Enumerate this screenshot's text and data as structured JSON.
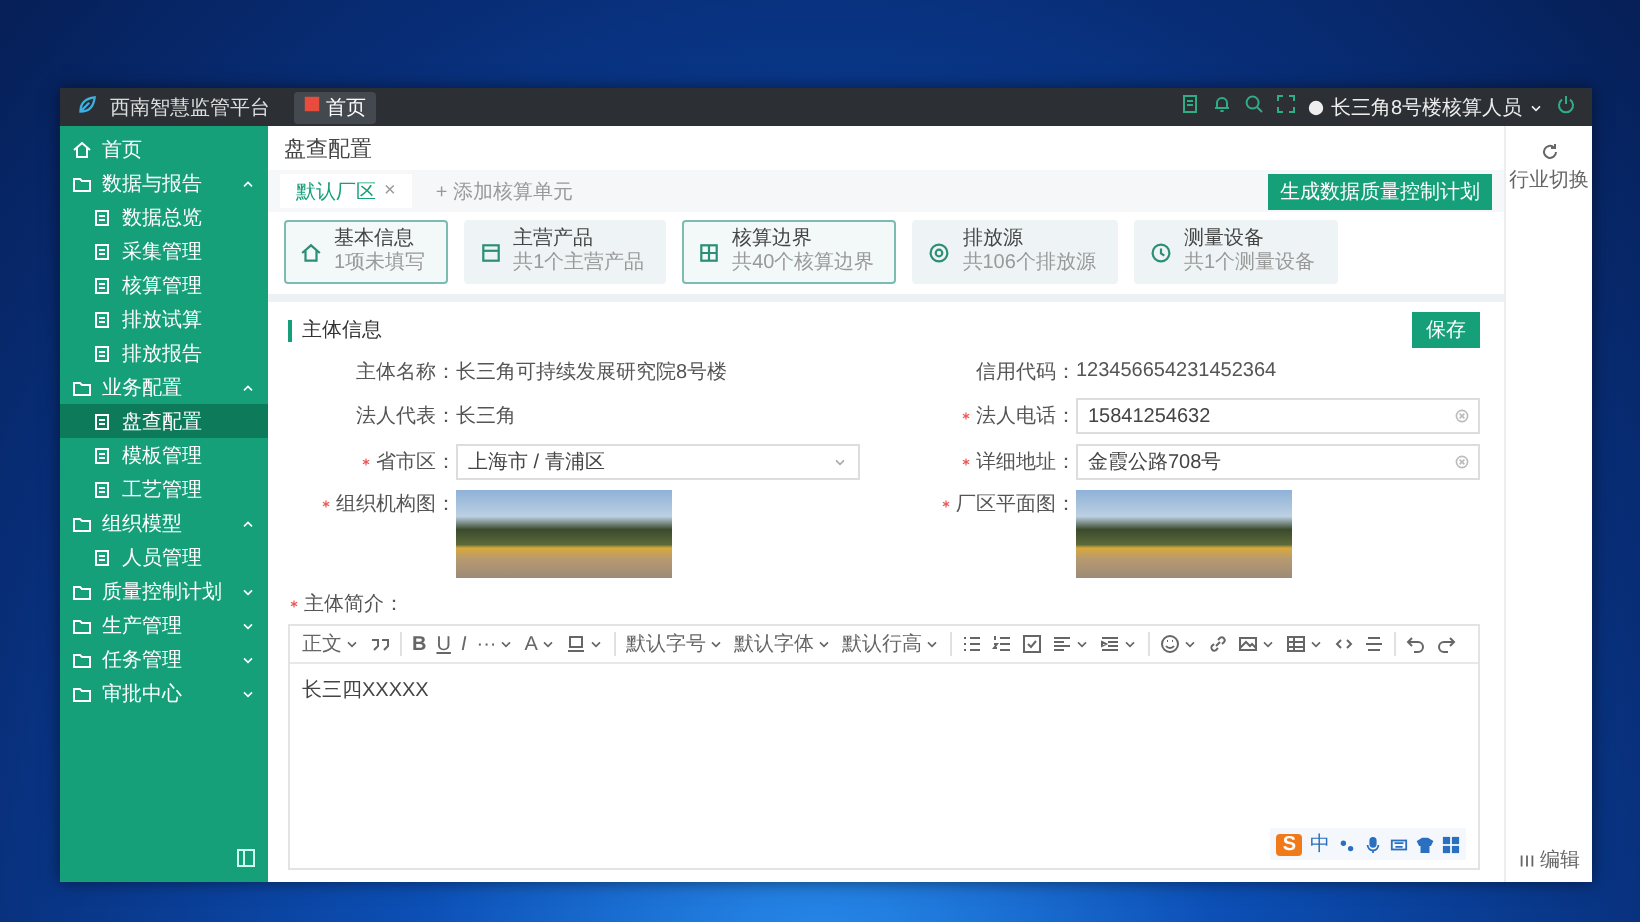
{
  "header": {
    "title": "西南智慧监管平台",
    "tabs": [
      {
        "label": "首页",
        "selected": true
      }
    ],
    "user": "长三角8号楼核算人员"
  },
  "sidebar": {
    "items": [
      {
        "label": "首页",
        "selected": false
      },
      {
        "label": "数据与报告",
        "selected": false,
        "expanded": true,
        "children": [
          {
            "label": "数据总览",
            "selected": false
          },
          {
            "label": "采集管理",
            "selected": false
          },
          {
            "label": "核算管理",
            "selected": false
          },
          {
            "label": "排放试算",
            "selected": false
          },
          {
            "label": "排放报告",
            "selected": false
          }
        ]
      },
      {
        "label": "业务配置",
        "selected": false,
        "expanded": true,
        "children": [
          {
            "label": "盘查配置",
            "selected": true
          },
          {
            "label": "模板管理",
            "selected": false
          },
          {
            "label": "工艺管理",
            "selected": false
          }
        ]
      },
      {
        "label": "组织模型",
        "selected": false,
        "expanded": true,
        "children": [
          {
            "label": "人员管理",
            "selected": false
          }
        ]
      },
      {
        "label": "质量控制计划",
        "selected": false,
        "expanded": false
      },
      {
        "label": "生产管理",
        "selected": false,
        "expanded": false
      },
      {
        "label": "任务管理",
        "selected": false,
        "expanded": false
      },
      {
        "label": "审批中心",
        "selected": false,
        "expanded": false
      }
    ]
  },
  "page_title": "盘查配置",
  "unit_tabs": [
    {
      "label": "默认厂区",
      "close": "×",
      "selected": true
    },
    {
      "label": "+ 添加核算单元",
      "selected": false
    }
  ],
  "generate_button": "生成数据质量控制计划",
  "steps": [
    {
      "title": "基本信息",
      "subtitle": "1项未填写",
      "selected": true
    },
    {
      "title": "主营产品",
      "subtitle": "共1个主营产品",
      "selected": false
    },
    {
      "title": "核算边界",
      "subtitle": "共40个核算边界",
      "selected": true
    },
    {
      "title": "排放源",
      "subtitle": "共106个排放源",
      "selected": false
    },
    {
      "title": "测量设备",
      "subtitle": "共1个测量设备",
      "selected": false
    }
  ],
  "form": {
    "section": "主体信息",
    "save": "保存",
    "fields": [
      {
        "kind": "text",
        "label": "主体名称：",
        "required": false,
        "value": "长三角可持续发展研究院8号楼"
      },
      {
        "kind": "text",
        "label": "信用代码：",
        "required": false,
        "value": "123456654231452364"
      },
      {
        "kind": "text",
        "label": "法人代表：",
        "required": false,
        "value": "长三角"
      },
      {
        "kind": "input",
        "label": "法人电话：",
        "required": true,
        "value": "15841254632"
      },
      {
        "kind": "select",
        "label": "省市区：",
        "required": true,
        "value": "上海市 / 青浦区"
      },
      {
        "kind": "input",
        "label": "详细地址：",
        "required": true,
        "value": "金霞公路708号"
      },
      {
        "kind": "image",
        "label": "组织机构图：",
        "required": true
      },
      {
        "kind": "image",
        "label": "厂区平面图：",
        "required": true
      }
    ],
    "intro": {
      "label": "主体简介：",
      "required": true,
      "content": "长三四XXXXX",
      "toolbar": [
        {
          "kind": "text",
          "label": "正文",
          "dropdown": true
        },
        {
          "kind": "quote"
        },
        {
          "kind": "divider"
        },
        {
          "kind": "bold",
          "label": "B"
        },
        {
          "kind": "underline",
          "label": "U"
        },
        {
          "kind": "italic",
          "label": "I"
        },
        {
          "kind": "text",
          "label": "···",
          "dropdown": true
        },
        {
          "kind": "text",
          "label": "A",
          "dropdown": true
        },
        {
          "kind": "fill",
          "dropdown": true
        },
        {
          "kind": "divider"
        },
        {
          "kind": "text",
          "label": "默认字号",
          "dropdown": true
        },
        {
          "kind": "text",
          "label": "默认字体",
          "dropdown": true
        },
        {
          "kind": "text",
          "label": "默认行高",
          "dropdown": true
        },
        {
          "kind": "divider"
        },
        {
          "kind": "bullets"
        },
        {
          "kind": "numbers"
        },
        {
          "kind": "todo"
        },
        {
          "kind": "align",
          "dropdown": true
        },
        {
          "kind": "indent",
          "dropdown": true
        },
        {
          "kind": "divider"
        },
        {
          "kind": "emoji",
          "dropdown": true
        },
        {
          "kind": "link"
        },
        {
          "kind": "image",
          "dropdown": true
        },
        {
          "kind": "table",
          "dropdown": true
        },
        {
          "kind": "code"
        },
        {
          "kind": "rule"
        },
        {
          "kind": "divider"
        },
        {
          "kind": "undo"
        },
        {
          "kind": "redo"
        }
      ]
    }
  },
  "ime_bar": {
    "logo": "S",
    "mode": "中"
  },
  "right_panel": {
    "top": "行业切换",
    "bottom": "编辑"
  }
}
